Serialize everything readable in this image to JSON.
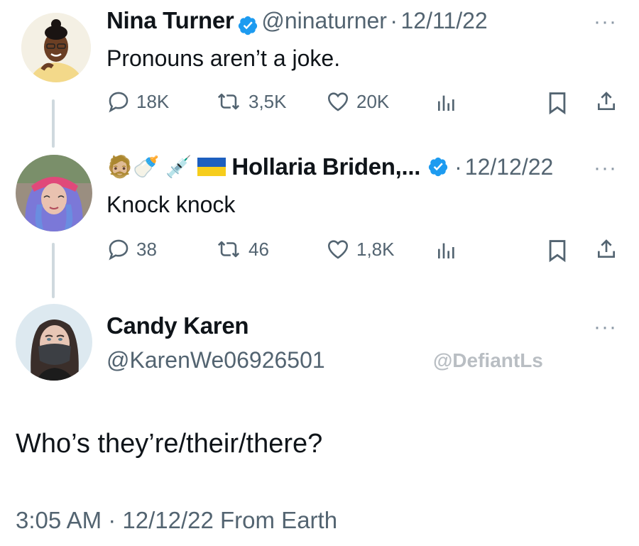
{
  "tweets": [
    {
      "name": "Nina Turner",
      "handle": "@ninaturner",
      "sep": "·",
      "date": "12/11/22",
      "text": "Pronouns aren’t a joke.",
      "replies": "18K",
      "retweets": "3,5K",
      "likes": "20K"
    },
    {
      "emoji_prefix": "🧔🏼‍🍼 💉",
      "name": "Hollaria Briden,...",
      "sep": "·",
      "date": "12/12/22",
      "text": "Knock knock",
      "replies": "38",
      "retweets": "46",
      "likes": "1,8K"
    }
  ],
  "main_tweet": {
    "name": "Candy Karen",
    "handle": "@KarenWe06926501",
    "watermark": "@DefiantLs",
    "text": "Who’s they’re/their/there?",
    "meta": "3:05 AM · 12/12/22 From Earth"
  },
  "more_label": "···",
  "colors": {
    "verified": "#1d9bf0",
    "muted": "#536471",
    "thread_line": "#cfd9de"
  }
}
